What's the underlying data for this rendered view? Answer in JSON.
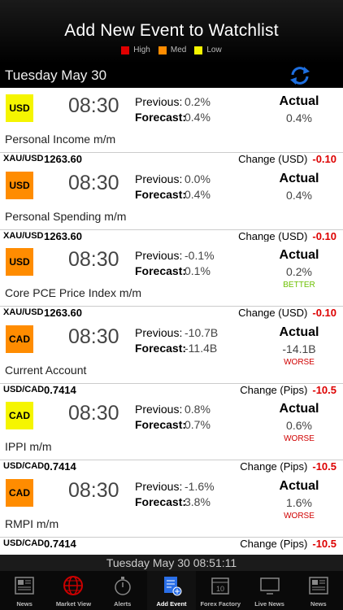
{
  "header": {
    "title": "Add New Event to Watchlist"
  },
  "legend": [
    {
      "label": "High",
      "color": "#e00000"
    },
    {
      "label": "Med",
      "color": "#ff8c00"
    },
    {
      "label": "Low",
      "color": "#f5f500"
    }
  ],
  "date_bar": {
    "date": "Tuesday May 30",
    "refresh_icon": "refresh-icon"
  },
  "events": [
    {
      "currency": "USD",
      "impact_color": "#f5f500",
      "time": "08:30",
      "previous_label": "Previous:",
      "previous": "0.2%",
      "forecast_label": "Forecast:",
      "forecast": "0.4%",
      "actual_label": "Actual",
      "actual": "0.4%",
      "note": "",
      "note_color": "",
      "name": "Personal Income m/m",
      "pair": "XAU/USD",
      "price": "1263.60",
      "change_label": "Change (USD)",
      "change": "-0.10"
    },
    {
      "currency": "USD",
      "impact_color": "#ff8c00",
      "time": "08:30",
      "previous_label": "Previous:",
      "previous": "0.0%",
      "forecast_label": "Forecast:",
      "forecast": "0.4%",
      "actual_label": "Actual",
      "actual": "0.4%",
      "note": "",
      "note_color": "",
      "name": "Personal Spending m/m",
      "pair": "XAU/USD",
      "price": "1263.60",
      "change_label": "Change (USD)",
      "change": "-0.10"
    },
    {
      "currency": "USD",
      "impact_color": "#ff8c00",
      "time": "08:30",
      "previous_label": "Previous:",
      "previous": "-0.1%",
      "forecast_label": "Forecast:",
      "forecast": "0.1%",
      "actual_label": "Actual",
      "actual": "0.2%",
      "note": "BETTER",
      "note_color": "#6cc000",
      "name": "Core PCE Price Index m/m",
      "pair": "XAU/USD",
      "price": "1263.60",
      "change_label": "Change (USD)",
      "change": "-0.10"
    },
    {
      "currency": "CAD",
      "impact_color": "#ff8c00",
      "time": "08:30",
      "previous_label": "Previous:",
      "previous": "-10.7B",
      "forecast_label": "Forecast:",
      "forecast": "-11.4B",
      "actual_label": "Actual",
      "actual": "-14.1B",
      "note": "WORSE",
      "note_color": "#d00000",
      "name": "Current Account",
      "pair": "USD/CAD",
      "price": "0.7414",
      "change_label": "Change (Pips)",
      "change": "-10.5"
    },
    {
      "currency": "CAD",
      "impact_color": "#f5f500",
      "time": "08:30",
      "previous_label": "Previous:",
      "previous": "0.8%",
      "forecast_label": "Forecast:",
      "forecast": "0.7%",
      "actual_label": "Actual",
      "actual": "0.6%",
      "note": "WORSE",
      "note_color": "#d00000",
      "name": "IPPI m/m",
      "pair": "USD/CAD",
      "price": "0.7414",
      "change_label": "Change (Pips)",
      "change": "-10.5"
    },
    {
      "currency": "CAD",
      "impact_color": "#ff8c00",
      "time": "08:30",
      "previous_label": "Previous:",
      "previous": "-1.6%",
      "forecast_label": "Forecast:",
      "forecast": "3.8%",
      "actual_label": "Actual",
      "actual": "1.6%",
      "note": "WORSE",
      "note_color": "#d00000",
      "name": "RMPI m/m",
      "pair": "USD/CAD",
      "price": "0.7414",
      "change_label": "Change (Pips)",
      "change": "-10.5"
    }
  ],
  "clock_bar": {
    "text": "Tuesday May 30 08:51:11"
  },
  "tabs": [
    {
      "label": "News",
      "icon": "newspaper-icon",
      "active": false
    },
    {
      "label": "Market View",
      "icon": "globe-icon",
      "active": false
    },
    {
      "label": "Alerts",
      "icon": "stopwatch-icon",
      "active": false
    },
    {
      "label": "Add Event",
      "icon": "add-list-icon",
      "active": true
    },
    {
      "label": "Forex Factory",
      "icon": "calendar-icon",
      "active": false
    },
    {
      "label": "Live News",
      "icon": "tv-icon",
      "active": false
    },
    {
      "label": "News",
      "icon": "newspaper-icon",
      "active": false
    }
  ]
}
